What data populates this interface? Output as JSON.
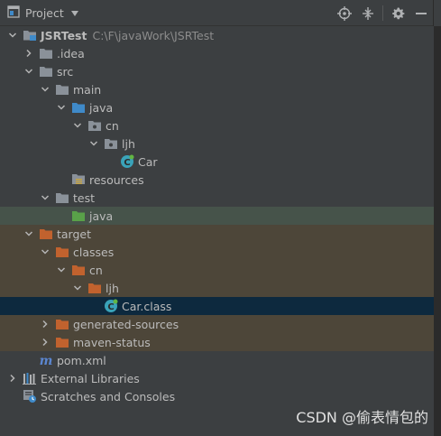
{
  "toolbar": {
    "title": "Project",
    "icons": [
      "project-view-icon",
      "dropdown-caret-icon",
      "locate-target-icon",
      "collapse-all-icon",
      "settings-gear-icon",
      "hide-minus-icon"
    ]
  },
  "tree": {
    "project": {
      "label": "JSRTest",
      "path": "C:\\F\\javaWork\\JSRTest"
    },
    "idea": "idea",
    "src": "src",
    "main": "main",
    "java_main": "java",
    "cn": "cn",
    "ljh": "ljh",
    "car": "Car",
    "resources": "resources",
    "test": "test",
    "java_test": "java",
    "target": "target",
    "classes": "classes",
    "target_cn": "cn",
    "target_ljh": "ljh",
    "car_class": "Car.class",
    "generated_sources": "generated-sources",
    "maven_status": "maven-status",
    "pom": "pom.xml",
    "external_libraries": "External Libraries",
    "scratches": "Scratches and Consoles"
  },
  "colors": {
    "folder": "#8a9199",
    "source_folder": "#3f8ac9",
    "test_folder": "#59a149",
    "excluded_folder": "#c1622e",
    "class_icon": "#3aa3b9",
    "maven_m": "#5b86d0"
  },
  "watermark": "CSDN @偷表情包的"
}
